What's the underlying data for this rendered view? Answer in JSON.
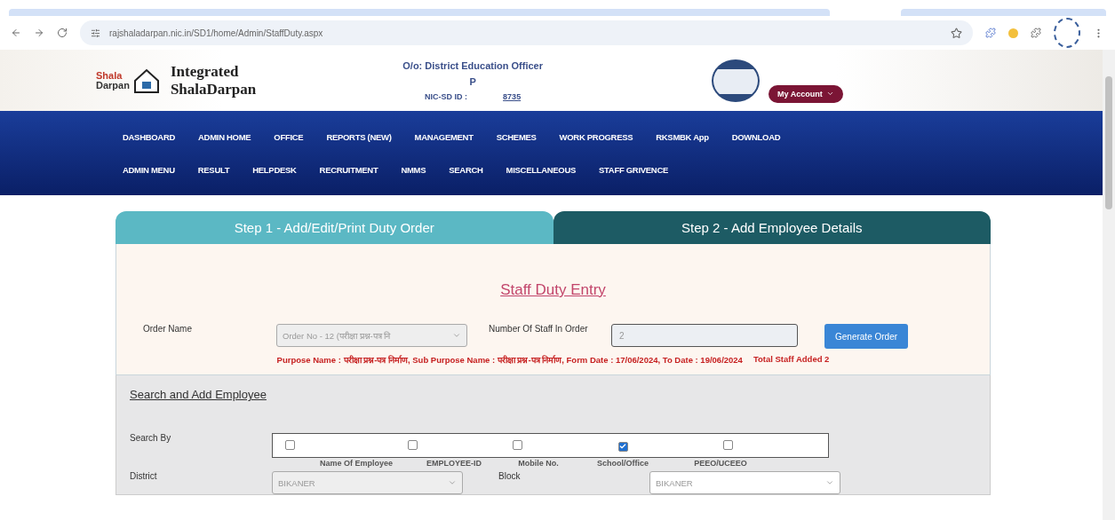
{
  "browser": {
    "url": "rajshaladarpan.nic.in/SD1/home/Admin/StaffDuty.aspx"
  },
  "header": {
    "logo_top": "Shala",
    "logo_bottom": "Darpan",
    "brand_line1": "Integrated",
    "brand_line2": "ShalaDarpan",
    "office": "O/o: District Education Officer",
    "office_line2": "P",
    "nic_label": "NIC-SD ID :",
    "nic_value": "8735",
    "account_button": "My Account"
  },
  "nav_rows": [
    [
      "DASHBOARD",
      "ADMIN HOME",
      "OFFICE",
      "REPORTS (NEW)",
      "MANAGEMENT",
      "SCHEMES",
      "WORK PROGRESS",
      "RKSMBK App",
      "DOWNLOAD"
    ],
    [
      "ADMIN MENU",
      "RESULT",
      "HELPDESK",
      "RECRUITMENT",
      "NMMS",
      "SEARCH",
      "MISCELLANEOUS",
      "STAFF GRIVENCE"
    ]
  ],
  "steps": [
    {
      "label": "Step 1 - Add/Edit/Print Duty Order",
      "selected": true
    },
    {
      "label": "Step 2 - Add Employee Details",
      "selected": false
    }
  ],
  "entry": {
    "title": "Staff Duty Entry",
    "order_label": "Order Name",
    "order_value": "Order No - 12 (परीक्षा प्रश्न-पत्र नि",
    "count_label": "Number Of Staff In Order",
    "count_value": "2",
    "generate_button": "Generate Order",
    "purpose": "Purpose Name : परीक्षा प्रश्न-पत्र निर्माण, Sub Purpose Name : परीक्षा प्रश्न-पत्र निर्माण, Form Date : 17/06/2024, To Date : 19/06/2024",
    "total": "Total Staff Added 2"
  },
  "search": {
    "title": "Search and Add Employee",
    "search_by_label": "Search By",
    "options": [
      {
        "label": "Name Of Employee",
        "checked": false
      },
      {
        "label": "EMPLOYEE-ID",
        "checked": false
      },
      {
        "label": "Mobile No.",
        "checked": false
      },
      {
        "label": "School/Office",
        "checked": true
      },
      {
        "label": "PEEO/UCEEO",
        "checked": false
      }
    ],
    "district_label": "District",
    "district_value": "BIKANER",
    "block_label": "Block",
    "block_value": "BIKANER"
  }
}
